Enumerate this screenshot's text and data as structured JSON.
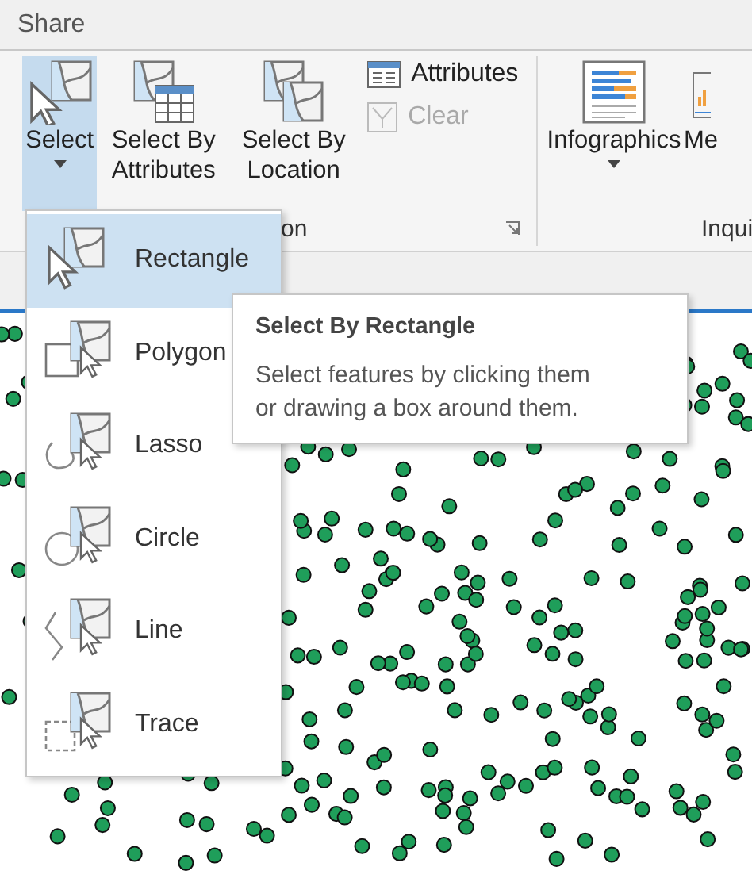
{
  "tab_bar": {
    "title": "Share"
  },
  "ribbon": {
    "groups": [
      {
        "label": "on",
        "large_buttons": [
          {
            "label": "Select",
            "selected": true,
            "dropdown": true
          },
          {
            "label": "Select By Attributes",
            "selected": false
          },
          {
            "label": "Select By Location",
            "selected": false
          }
        ],
        "small_buttons": [
          {
            "label": "Attributes",
            "disabled": false
          },
          {
            "label": "Clear",
            "disabled": true
          }
        ],
        "launcher": true
      },
      {
        "label": "Inqui",
        "large_buttons": [
          {
            "label": "Infographics",
            "selected": false,
            "dropdown": true
          },
          {
            "label": "Me",
            "selected": false
          }
        ]
      }
    ]
  },
  "select_menu": {
    "items": [
      {
        "label": "Rectangle",
        "selected": true
      },
      {
        "label": "Polygon",
        "selected": false
      },
      {
        "label": "Lasso",
        "selected": false
      },
      {
        "label": "Circle",
        "selected": false
      },
      {
        "label": "Line",
        "selected": false
      },
      {
        "label": "Trace",
        "selected": false
      }
    ]
  },
  "tooltip": {
    "title": "Select By Rectangle",
    "body": "Select features by clicking them or drawing a box around them."
  }
}
